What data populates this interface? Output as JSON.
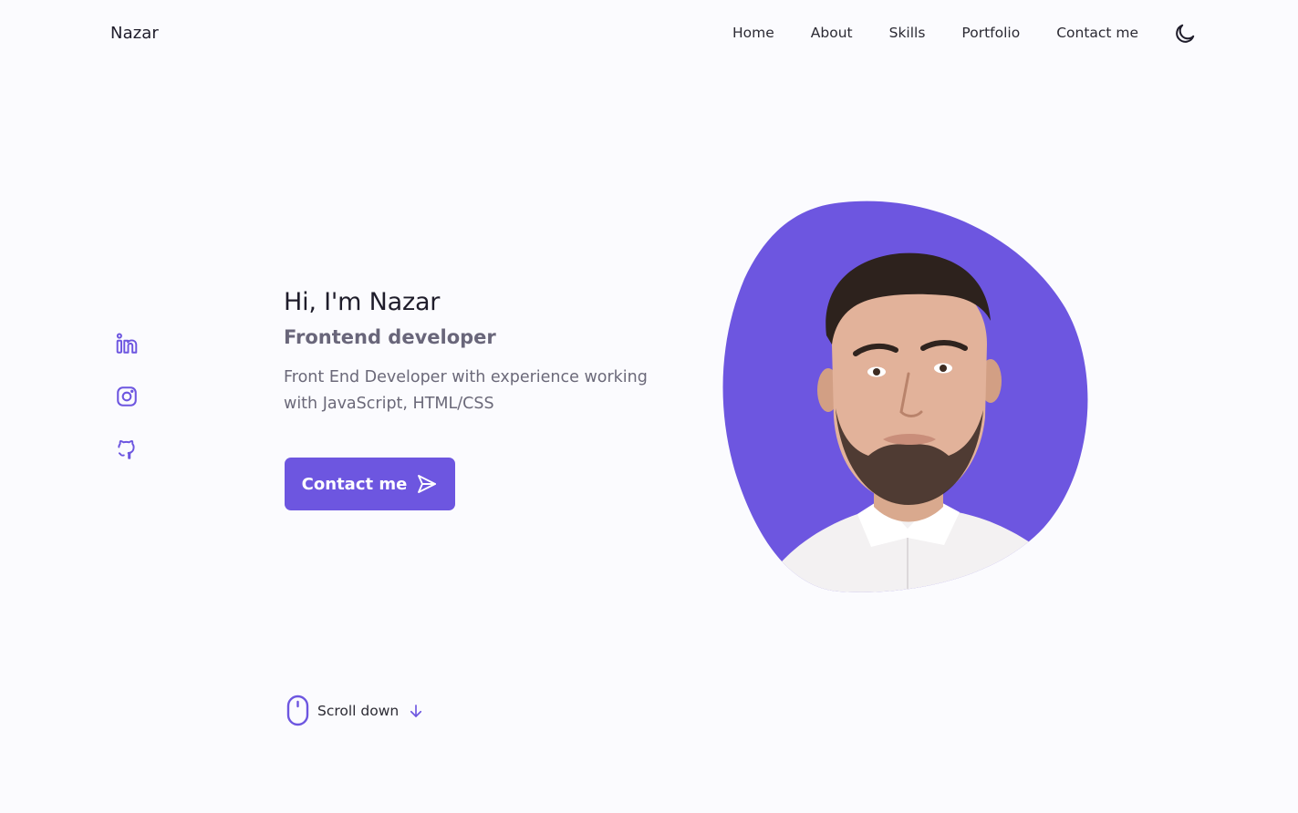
{
  "header": {
    "logo": "Nazar",
    "nav": [
      {
        "label": "Home"
      },
      {
        "label": "About"
      },
      {
        "label": "Skills"
      },
      {
        "label": "Portfolio"
      },
      {
        "label": "Contact me"
      }
    ],
    "theme_icon": "moon-icon"
  },
  "social": [
    {
      "icon": "linkedin-icon"
    },
    {
      "icon": "instagram-icon"
    },
    {
      "icon": "github-icon"
    }
  ],
  "intro": {
    "title": "Hi, I'm Nazar",
    "subtitle": "Frontend developer",
    "description": "Front End Developer with experience working with JavaScript, HTML/CSS",
    "cta_label": "Contact me",
    "cta_icon": "send-icon"
  },
  "scroll": {
    "label": "Scroll down",
    "mouse_icon": "mouse-icon",
    "arrow_icon": "arrow-down-icon"
  },
  "colors": {
    "accent": "#6d56e0",
    "background": "#fbfbfe",
    "text": "#2b2a33",
    "muted": "#6b6979"
  }
}
